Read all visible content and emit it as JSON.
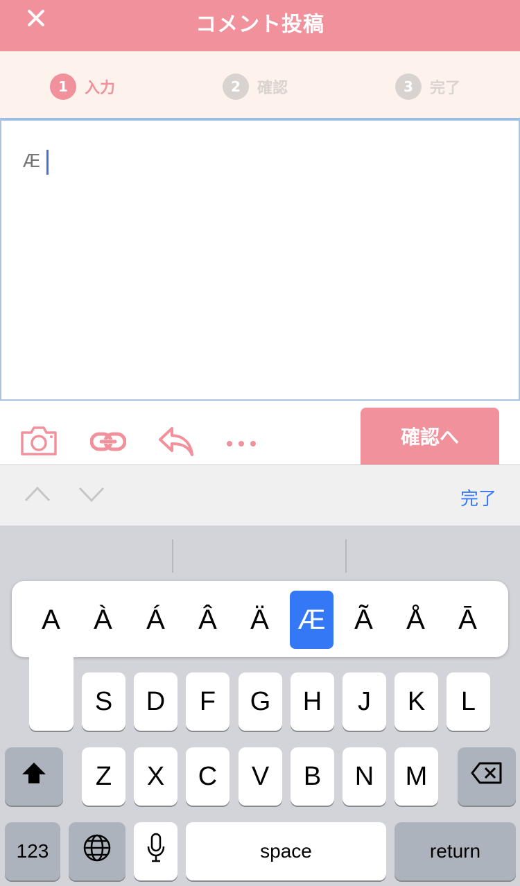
{
  "header": {
    "title": "コメント投稿",
    "close_icon": "close-icon"
  },
  "steps": [
    {
      "num": "1",
      "label": "入力"
    },
    {
      "num": "2",
      "label": "確認"
    },
    {
      "num": "3",
      "label": "完了"
    }
  ],
  "editor": {
    "text": "Æ"
  },
  "toolbar": {
    "icons": [
      "camera-icon",
      "link-icon",
      "reply-icon",
      "more-icon"
    ],
    "confirm_label": "確認へ"
  },
  "accessory": {
    "done_label": "完了"
  },
  "popup": {
    "options": [
      "A",
      "À",
      "Á",
      "Â",
      "Ä",
      "Æ",
      "Ã",
      "Å",
      "Ā"
    ],
    "selected": "Æ"
  },
  "keyboard": {
    "row2": [
      "S",
      "D",
      "F",
      "G",
      "H",
      "J",
      "K",
      "L"
    ],
    "row3": [
      "Z",
      "X",
      "C",
      "V",
      "B",
      "N",
      "M"
    ],
    "numbers_label": "123",
    "space_label": "space",
    "return_label": "return"
  },
  "colors": {
    "accent": "#f0919b",
    "selection": "#3478f6",
    "step_bg": "#fdf3ec"
  }
}
